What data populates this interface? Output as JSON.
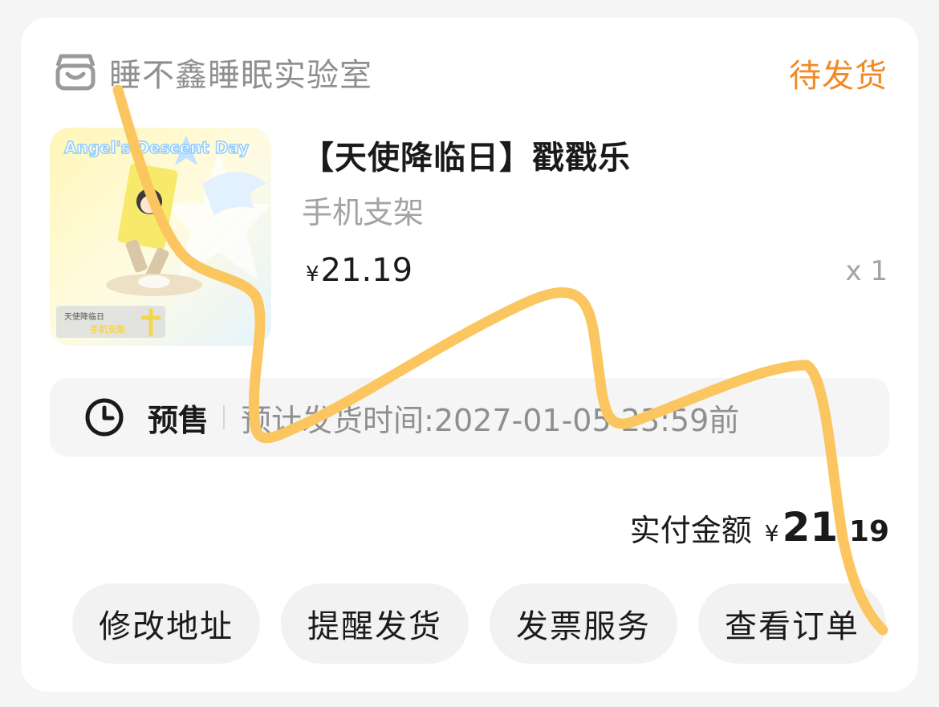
{
  "shop": {
    "icon": "storefront-icon",
    "name": "睡不鑫睡眠实验室",
    "status": "待发货",
    "status_color": "#f08a24"
  },
  "product": {
    "title": "【天使降临日】戳戳乐",
    "variant": "手机支架",
    "price_symbol": "¥",
    "price": "21.19",
    "quantity": "x 1",
    "image": {
      "banner_text": "Angel's Descent Day",
      "tag_line1": "天使降临日",
      "tag_line2": "手机支架"
    }
  },
  "presale": {
    "icon": "clock-icon",
    "label": "预售",
    "ship_text": "预计发货时间:2027-01-05 23:59前"
  },
  "total": {
    "label": "实付金额",
    "symbol": "¥",
    "integer": "21",
    "decimal": ".19"
  },
  "actions": [
    {
      "label": "修改地址"
    },
    {
      "label": "提醒发货"
    },
    {
      "label": "发票服务"
    },
    {
      "label": "查看订单"
    }
  ],
  "annotation": {
    "stroke_color": "#fbc65f"
  }
}
